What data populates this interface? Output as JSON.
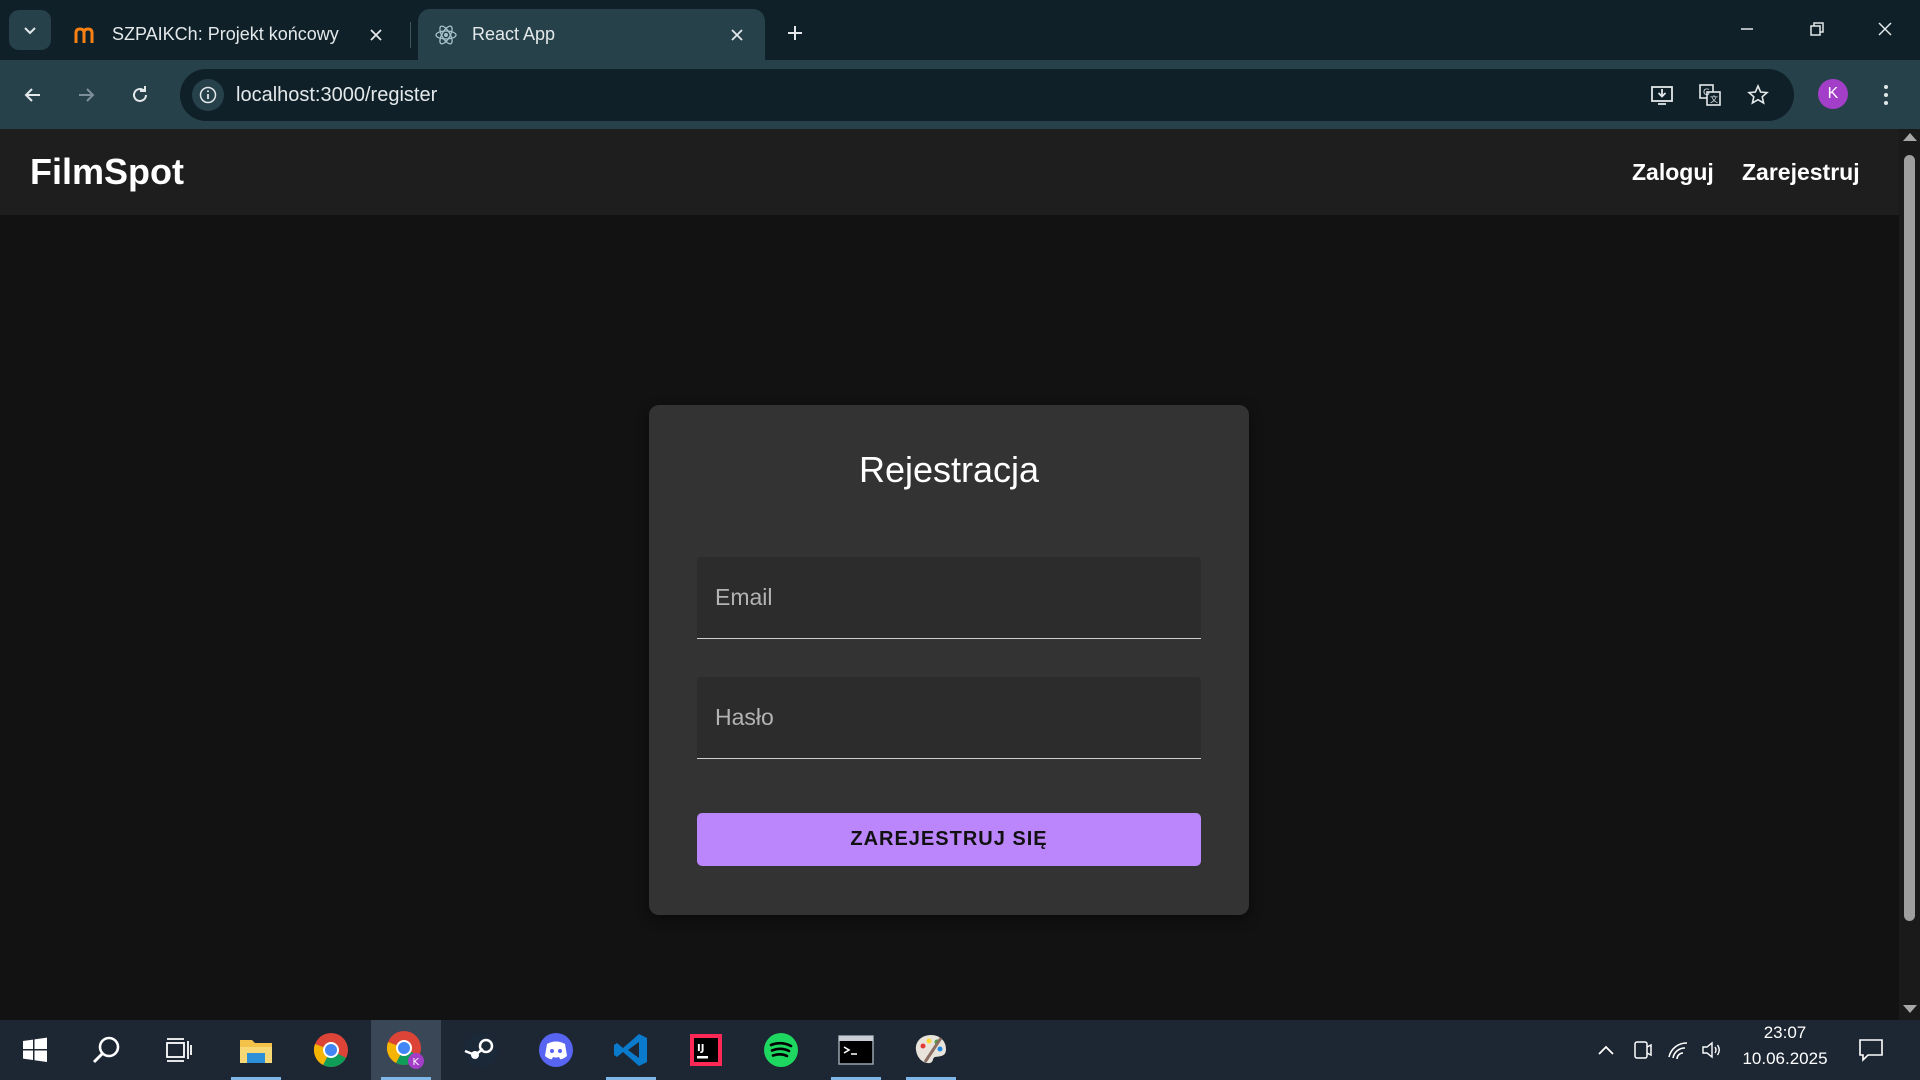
{
  "browser": {
    "tabs": [
      {
        "title": "SZPAIKCh: Projekt końcowy",
        "favicon": "moodle-icon",
        "active": false
      },
      {
        "title": "React App",
        "favicon": "react-icon",
        "active": true
      }
    ],
    "url": "localhost:3000/register",
    "profile_initial": "K"
  },
  "app": {
    "brand": "FilmSpot",
    "nav": {
      "login": "Zaloguj",
      "register": "Zarejestruj"
    }
  },
  "register_form": {
    "title": "Rejestracja",
    "email_placeholder": "Email",
    "email_value": "",
    "password_placeholder": "Hasło",
    "password_value": "",
    "submit_label": "ZAREJESTRUJ SIĘ"
  },
  "taskbar": {
    "apps": [
      "windows-start",
      "search",
      "task-view",
      "file-explorer",
      "chrome",
      "chrome-profile",
      "steam",
      "discord",
      "vscode",
      "intellij",
      "spotify",
      "terminal",
      "paint"
    ],
    "active_app": "chrome-profile",
    "time": "23:07",
    "date": "10.06.2025"
  },
  "colors": {
    "accent": "#bb86fc",
    "header_bg": "#1e1e1e",
    "page_bg": "#121212",
    "card_bg": "#333333",
    "browser_frame": "#0f2028",
    "browser_toolbar": "#27414b"
  }
}
